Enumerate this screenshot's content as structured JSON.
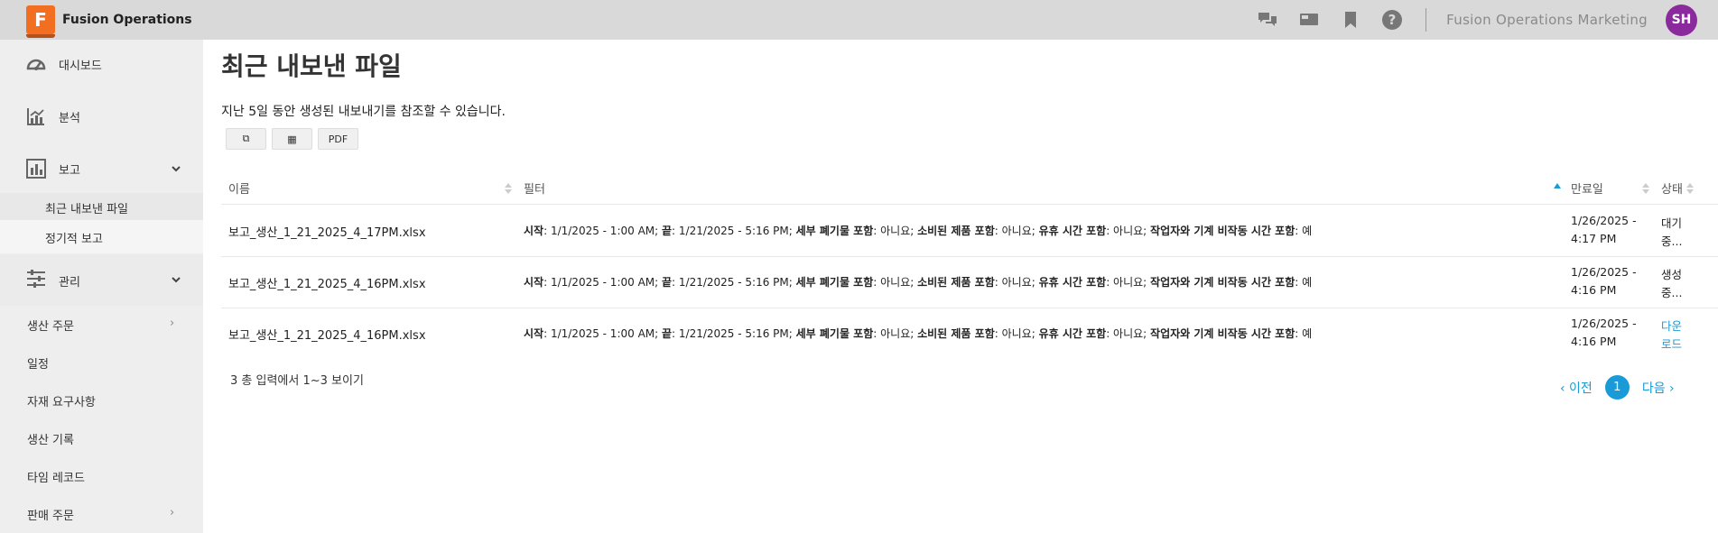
{
  "app": {
    "logo_letter": "F",
    "title": "Fusion Operations",
    "org": "Fusion Operations Marketing",
    "avatar_initials": "SH"
  },
  "topbar": {
    "icons": [
      "chat-icon",
      "video-icon",
      "bookmark-icon",
      "help-icon"
    ]
  },
  "sidebar": {
    "dashboard": "대시보드",
    "analysis": "분석",
    "reports": "보고",
    "reports_sub": [
      "최근 내보낸 파일",
      "정기적 보고"
    ],
    "management": "관리",
    "lower": [
      {
        "label": "생산 주문",
        "chevron": "›"
      },
      {
        "label": "일정",
        "chevron": ""
      },
      {
        "label": "자재 요구사항",
        "chevron": ""
      },
      {
        "label": "생산 기록",
        "chevron": ""
      },
      {
        "label": "타임 레코드",
        "chevron": ""
      },
      {
        "label": "판매 주문",
        "chevron": "›"
      }
    ]
  },
  "main": {
    "title": "최근 내보낸 파일",
    "subtitle": "지난 5일 동안 생성된 내보내기를 참조할 수 있습니다.",
    "buttons": {
      "copy": "⧉",
      "csv": "▦",
      "pdf": "PDF"
    },
    "columns": {
      "name": "이름",
      "filter": "필터",
      "expiry": "만료일",
      "status": "상태"
    },
    "rows": [
      {
        "name": "보고_생산_1_21_2025_4_17PM.xlsx",
        "filter": {
          "k1": "시작",
          "v1": ": 1/1/2025 - 1:00 AM; ",
          "k2": "끝",
          "v2": ": 1/21/2025 - 5:16 PM; ",
          "k3": "세부 폐기물 포함",
          "v3": ": 아니요; ",
          "k4": "소비된 제품 포함",
          "v4": ": 아니요; ",
          "k5": "유휴 시간 포함",
          "v5": ": 아니요; ",
          "k6": "작업자와 기계 비작동 시간 포함",
          "v6": ": 예"
        },
        "expiry_date": "1/26/2025 -",
        "expiry_time": "4:17 PM",
        "status_1": "대기",
        "status_2": "중..."
      },
      {
        "name": "보고_생산_1_21_2025_4_16PM.xlsx",
        "filter": {
          "k1": "시작",
          "v1": ": 1/1/2025 - 1:00 AM; ",
          "k2": "끝",
          "v2": ": 1/21/2025 - 5:16 PM; ",
          "k3": "세부 폐기물 포함",
          "v3": ": 아니요; ",
          "k4": "소비된 제품 포함",
          "v4": ": 아니요; ",
          "k5": "유휴 시간 포함",
          "v5": ": 아니요; ",
          "k6": "작업자와 기계 비작동 시간 포함",
          "v6": ": 예"
        },
        "expiry_date": "1/26/2025 -",
        "expiry_time": "4:16 PM",
        "status_1": "생성",
        "status_2": "중..."
      },
      {
        "name": "보고_생산_1_21_2025_4_16PM.xlsx",
        "filter": {
          "k1": "시작",
          "v1": ": 1/1/2025 - 1:00 AM; ",
          "k2": "끝",
          "v2": ": 1/21/2025 - 5:16 PM; ",
          "k3": "세부 폐기물 포함",
          "v3": ": 아니요; ",
          "k4": "소비된 제품 포함",
          "v4": ": 아니요; ",
          "k5": "유휴 시간 포함",
          "v5": ": 아니요; ",
          "k6": "작업자와 기계 비작동 시간 포함",
          "v6": ": 예"
        },
        "expiry_date": "1/26/2025 -",
        "expiry_time": "4:16 PM",
        "status_1": "다운",
        "status_2": "로드"
      }
    ],
    "info": "3 총 입력에서 1~3 보이기",
    "pager": {
      "prev": "‹ 이전",
      "current": "1",
      "next": "다음 ›"
    }
  },
  "colors": {
    "accent": "#1a9ad6",
    "logo": "#f26f21",
    "avatar": "#8a2a9c"
  }
}
